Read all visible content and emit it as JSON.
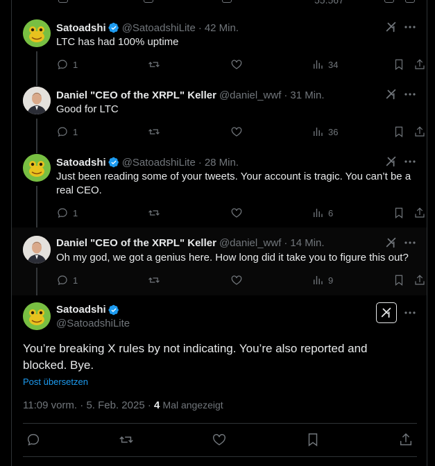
{
  "top_strip": {
    "views_partial": "55.567"
  },
  "replies": [
    {
      "name": "Satoadshi",
      "verified": true,
      "handle": "@SatoadshiLite",
      "time": "42 Min.",
      "text": "LTC has had 100% uptime",
      "reply_count": "1",
      "view_count": "34",
      "avatar": "frog-avatar"
    },
    {
      "name": "Daniel \"CEO of the XRPL\" Keller",
      "verified": false,
      "handle": "@daniel_wwf",
      "time": "31 Min.",
      "text": "Good for LTC",
      "reply_count": "1",
      "view_count": "36",
      "avatar": "man-avatar"
    },
    {
      "name": "Satoadshi",
      "verified": true,
      "handle": "@SatoadshiLite",
      "time": "28 Min.",
      "text": "Just been reading some of your tweets. Your account is tragic. You can’t be a real CEO.",
      "reply_count": "1",
      "view_count": "6",
      "avatar": "frog-avatar"
    },
    {
      "name": "Daniel \"CEO of the XRPL\" Keller",
      "verified": false,
      "handle": "@daniel_wwf",
      "time": "14 Min.",
      "text": "Oh my god, we got a genius here. How long did it take you to figure this out?",
      "reply_count": "1",
      "view_count": "9",
      "avatar": "man-avatar"
    }
  ],
  "main_post": {
    "name": "Satoadshi",
    "verified": true,
    "handle": "@SatoadshiLite",
    "text": "You’re breaking X rules by not indicating. You’re also reported and blocked. Bye.",
    "translate_label": "Post übersetzen",
    "time": "11:09 vorm.",
    "date": "5. Feb. 2025",
    "view_count": "4",
    "view_label": "Mal angezeigt",
    "separator": "·"
  },
  "colors": {
    "background": "#000000",
    "text": "#e7e9ea",
    "muted": "#71767b",
    "accent": "#1d9bf0",
    "border": "#2f3336"
  }
}
